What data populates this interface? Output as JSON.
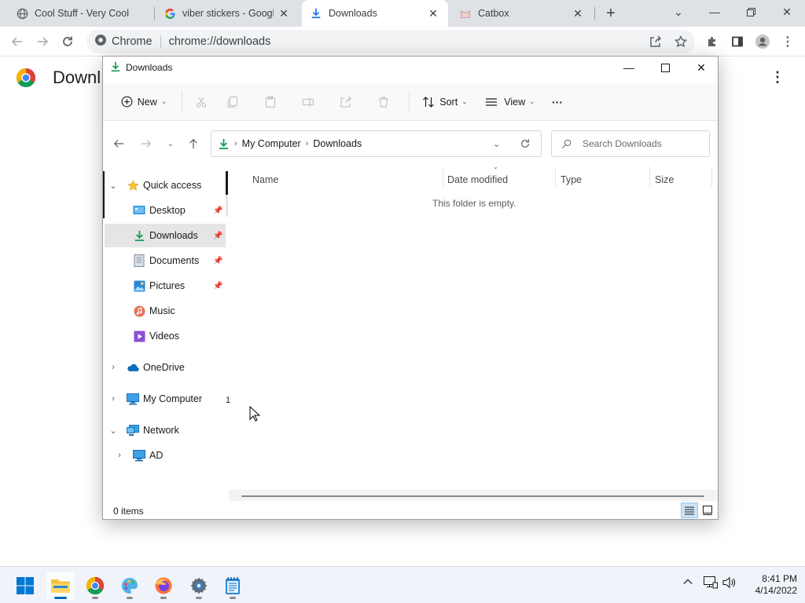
{
  "browser": {
    "tabs": [
      {
        "title": "Cool Stuff - Very Cool",
        "favicon": "globe-icon"
      },
      {
        "title": "viber stickers - Google",
        "favicon": "google-icon"
      },
      {
        "title": "Downloads",
        "favicon": "download-icon"
      },
      {
        "title": "Catbox",
        "favicon": "cat-icon"
      }
    ],
    "active_tab": 2,
    "omnibox": {
      "chip": "Chrome",
      "url": "chrome://downloads"
    },
    "page_title": "Downl"
  },
  "explorer": {
    "title": "Downloads",
    "commands": {
      "new": "New",
      "sort": "Sort",
      "view": "View",
      "more": "···"
    },
    "breadcrumb": [
      "My Computer",
      "Downloads"
    ],
    "search_placeholder": "Search Downloads",
    "nav": {
      "quick_access": "Quick access",
      "desktop": "Desktop",
      "downloads": "Downloads",
      "documents": "Documents",
      "pictures": "Pictures",
      "music": "Music",
      "videos": "Videos",
      "onedrive": "OneDrive",
      "my_computer": "My Computer",
      "network": "Network",
      "ad": "AD"
    },
    "stray_mark": "1",
    "columns": [
      "Name",
      "Date modified",
      "Type",
      "Size"
    ],
    "empty_message": "This folder is empty.",
    "status": "0 items"
  },
  "taskbar": {
    "apps": [
      "windows-start-icon",
      "file-explorer-icon",
      "chrome-icon",
      "paint-icon",
      "firefox-icon",
      "settings-icon",
      "notepad-icon"
    ],
    "time": "8:41 PM",
    "date": "4/14/2022"
  },
  "colors": {
    "accent": "#0067c0",
    "tabstrip": "#dee1e6",
    "download_green": "#1a9e5a",
    "folder_yellow": "#f8c33c"
  }
}
